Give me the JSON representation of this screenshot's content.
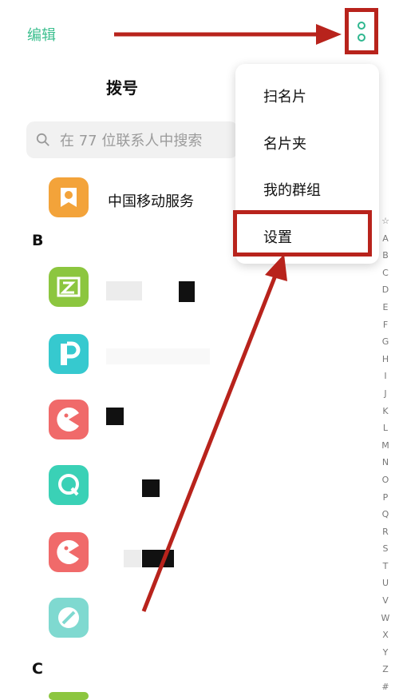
{
  "header": {
    "edit_label": "编辑",
    "more_icon": "more-vertical-icon"
  },
  "tabs": {
    "dial_label": "拨号"
  },
  "search": {
    "placeholder": "在 77 位联系人中搜索",
    "icon": "search-icon"
  },
  "contacts": {
    "featured": {
      "name": "中国移动服务",
      "icon_color": "#f3a33a"
    },
    "section_b": "B",
    "section_c": "C",
    "app_icons": [
      {
        "icon": "zhanghu-icon",
        "color": "#8cc63f"
      },
      {
        "icon": "p-icon",
        "color": "#36c9cf"
      },
      {
        "icon": "pacman-icon",
        "color": "#f06a6a"
      },
      {
        "icon": "q-icon",
        "color": "#3ad1b6"
      },
      {
        "icon": "pacman-icon",
        "color": "#f06a6a"
      },
      {
        "icon": "compass-icon",
        "color": "#7fd9d0"
      }
    ]
  },
  "menu": {
    "items": [
      "扫名片",
      "名片夹",
      "我的群组",
      "设置"
    ],
    "highlighted": "设置"
  },
  "alphabet_index": [
    "☆",
    "A",
    "B",
    "C",
    "D",
    "E",
    "F",
    "G",
    "H",
    "I",
    "J",
    "K",
    "L",
    "M",
    "N",
    "O",
    "P",
    "Q",
    "R",
    "S",
    "T",
    "U",
    "V",
    "W",
    "X",
    "Y",
    "Z",
    "#"
  ],
  "colors": {
    "accent": "#3dbf8f",
    "annotation": "#b8231c"
  }
}
